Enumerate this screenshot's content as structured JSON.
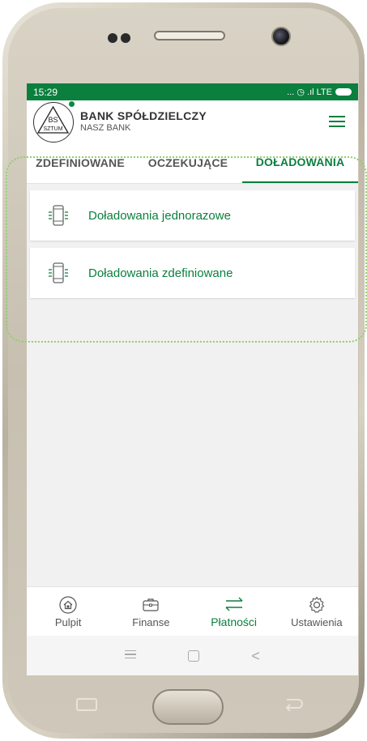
{
  "status_bar": {
    "time": "15:29",
    "indicators": "... ◷ .ıl LTE"
  },
  "header": {
    "logo_text_top": "BS",
    "logo_text_bottom": "SZTUM",
    "bank_name": "BANK SPÓŁDZIELCZY",
    "bank_subname": "NASZ BANK",
    "menu_icon": "hamburger-menu-icon"
  },
  "tabs": [
    {
      "label": "ZDEFINIOWANE",
      "active": false
    },
    {
      "label": "OCZEKUJĄCE",
      "active": false
    },
    {
      "label": "DOŁADOWANIA",
      "active": true
    }
  ],
  "items": [
    {
      "label": "Doładowania jednorazowe",
      "icon": "phone-topup-icon"
    },
    {
      "label": "Doładowania zdefiniowane",
      "icon": "phone-topup-icon"
    }
  ],
  "bottom_nav": [
    {
      "label": "Pulpit",
      "icon": "home-icon",
      "active": false
    },
    {
      "label": "Finanse",
      "icon": "wallet-icon",
      "active": false
    },
    {
      "label": "Płatności",
      "icon": "transfer-arrows-icon",
      "active": true
    },
    {
      "label": "Ustawienia",
      "icon": "gear-icon",
      "active": false
    }
  ],
  "colors": {
    "brand_green": "#0b7f3e",
    "highlight_outline": "#8fd06c"
  }
}
